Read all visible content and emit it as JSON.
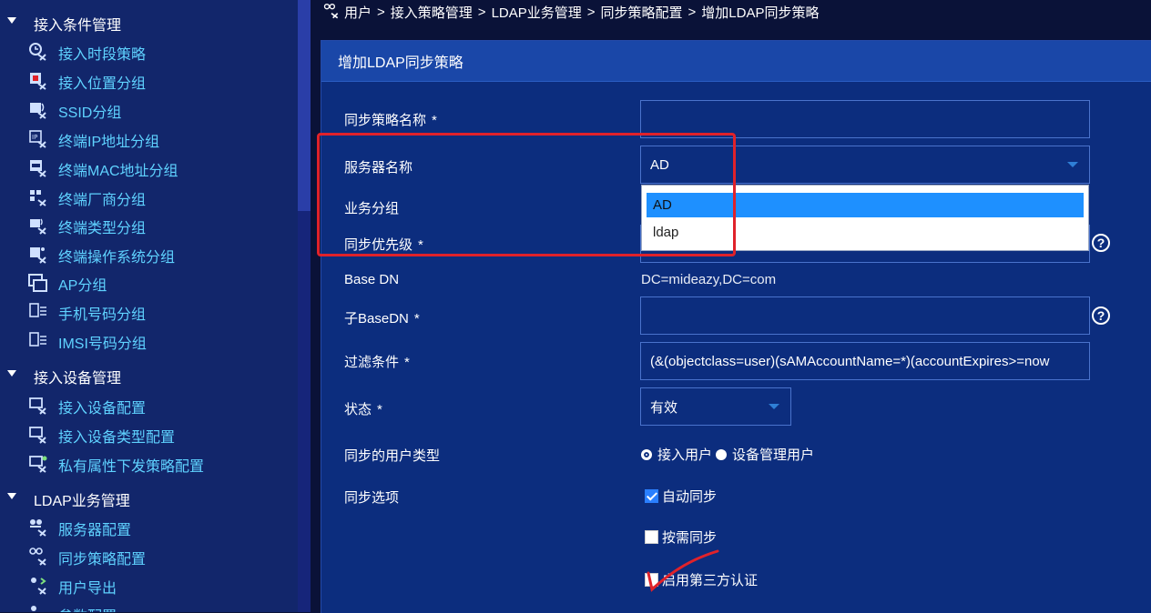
{
  "sidebar": {
    "groups": [
      {
        "label": "接入条件管理",
        "items": [
          {
            "label": "接入时段策略",
            "icon": "time-policy-icon"
          },
          {
            "label": "接入位置分组",
            "icon": "location-group-icon"
          },
          {
            "label": "SSID分组",
            "icon": "ssid-group-icon"
          },
          {
            "label": "终端IP地址分组",
            "icon": "ip-group-icon"
          },
          {
            "label": "终端MAC地址分组",
            "icon": "mac-group-icon"
          },
          {
            "label": "终端厂商分组",
            "icon": "vendor-group-icon"
          },
          {
            "label": "终端类型分组",
            "icon": "terminal-type-icon"
          },
          {
            "label": "终端操作系统分组",
            "icon": "os-group-icon"
          },
          {
            "label": "AP分组",
            "icon": "ap-group-icon"
          },
          {
            "label": "手机号码分组",
            "icon": "phone-group-icon"
          },
          {
            "label": "IMSI号码分组",
            "icon": "imsi-group-icon"
          }
        ]
      },
      {
        "label": "接入设备管理",
        "items": [
          {
            "label": "接入设备配置",
            "icon": "device-config-icon"
          },
          {
            "label": "接入设备类型配置",
            "icon": "device-type-icon"
          },
          {
            "label": "私有属性下发策略配置",
            "icon": "private-attr-icon"
          }
        ]
      },
      {
        "label": "LDAP业务管理",
        "items": [
          {
            "label": "服务器配置",
            "icon": "server-config-icon"
          },
          {
            "label": "同步策略配置",
            "icon": "sync-policy-icon"
          },
          {
            "label": "用户导出",
            "icon": "user-export-icon"
          },
          {
            "label": "参数配置",
            "icon": "param-config-icon"
          }
        ]
      }
    ]
  },
  "breadcrumb": [
    "用户",
    "接入策略管理",
    "LDAP业务管理",
    "同步策略配置",
    "增加LDAP同步策略"
  ],
  "breadcrumb_separator": ">",
  "panel": {
    "title": "增加LDAP同步策略"
  },
  "form": {
    "required_mark": "*",
    "policy_name": {
      "label": "同步策略名称",
      "value": ""
    },
    "server_name": {
      "label": "服务器名称",
      "value": "AD",
      "options": [
        "AD",
        "ldap"
      ]
    },
    "service_group": {
      "label": "业务分组"
    },
    "sync_priority": {
      "label": "同步优先级"
    },
    "base_dn": {
      "label": "Base DN",
      "value": "DC=mideazy,DC=com"
    },
    "sub_base_dn": {
      "label": "子BaseDN",
      "value": ""
    },
    "filter": {
      "label": "过滤条件",
      "value": "(&(objectclass=user)(sAMAccountName=*)(accountExpires>=now"
    },
    "status": {
      "label": "状态",
      "value": "有效"
    },
    "user_type": {
      "label": "同步的用户类型",
      "options": [
        "接入用户",
        "设备管理用户"
      ],
      "selected": "接入用户"
    },
    "sync_options": {
      "label": "同步选项",
      "items": [
        {
          "label": "自动同步",
          "checked": true
        },
        {
          "label": "按需同步",
          "checked": false
        },
        {
          "label": "启用第三方认证",
          "checked": false
        }
      ]
    },
    "help_glyph": "?"
  },
  "colors": {
    "sidebar_bg": "#12266b",
    "sidebar_link": "#5fd2ff",
    "panel_bg": "#0c2d7e",
    "panel_title_bg": "#1a47a8",
    "highlight_red": "#e0222a",
    "dropdown_selected": "#1e90ff"
  }
}
